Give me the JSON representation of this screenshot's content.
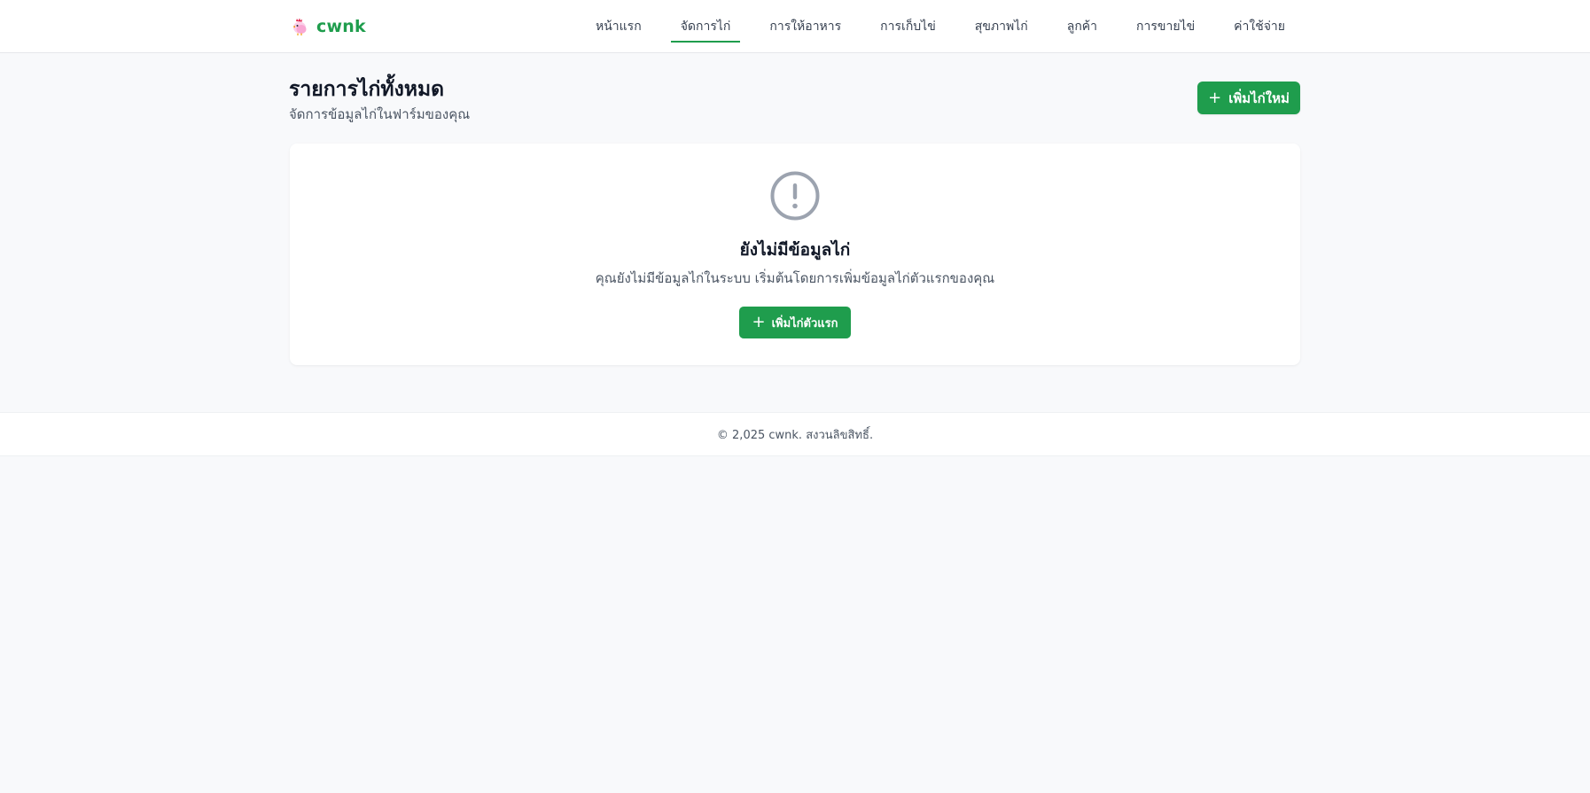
{
  "brand": {
    "name": "cwnk",
    "icon": "chicken-icon"
  },
  "nav": {
    "items": [
      {
        "label": "หน้าแรก",
        "active": false
      },
      {
        "label": "จัดการไก่",
        "active": true
      },
      {
        "label": "การให้อาหาร",
        "active": false
      },
      {
        "label": "การเก็บไข่",
        "active": false
      },
      {
        "label": "สุขภาพไก่",
        "active": false
      },
      {
        "label": "ลูกค้า",
        "active": false
      },
      {
        "label": "การขายไข่",
        "active": false
      },
      {
        "label": "ค่าใช้จ่าย",
        "active": false
      }
    ]
  },
  "header": {
    "title": "รายการไก่ทั้งหมด",
    "subtitle": "จัดการข้อมูลไก่ในฟาร์มของคุณ",
    "add_button_label": "เพิ่มไก่ใหม่"
  },
  "empty_state": {
    "icon": "exclamation-circle-icon",
    "title": "ยังไม่มีข้อมูลไก่",
    "description": "คุณยังไม่มีข้อมูลไก่ในระบบ เริ่มต้นโดยการเพิ่มข้อมูลไก่ตัวแรกของคุณ",
    "button_label": "เพิ่มไก่ตัวแรก"
  },
  "footer": {
    "text": "© 2,025 cwnk. สงวนลิขสิทธิ์."
  },
  "colors": {
    "accent": "#1f9d4d",
    "background": "#f8f9fb",
    "surface": "#ffffff"
  }
}
